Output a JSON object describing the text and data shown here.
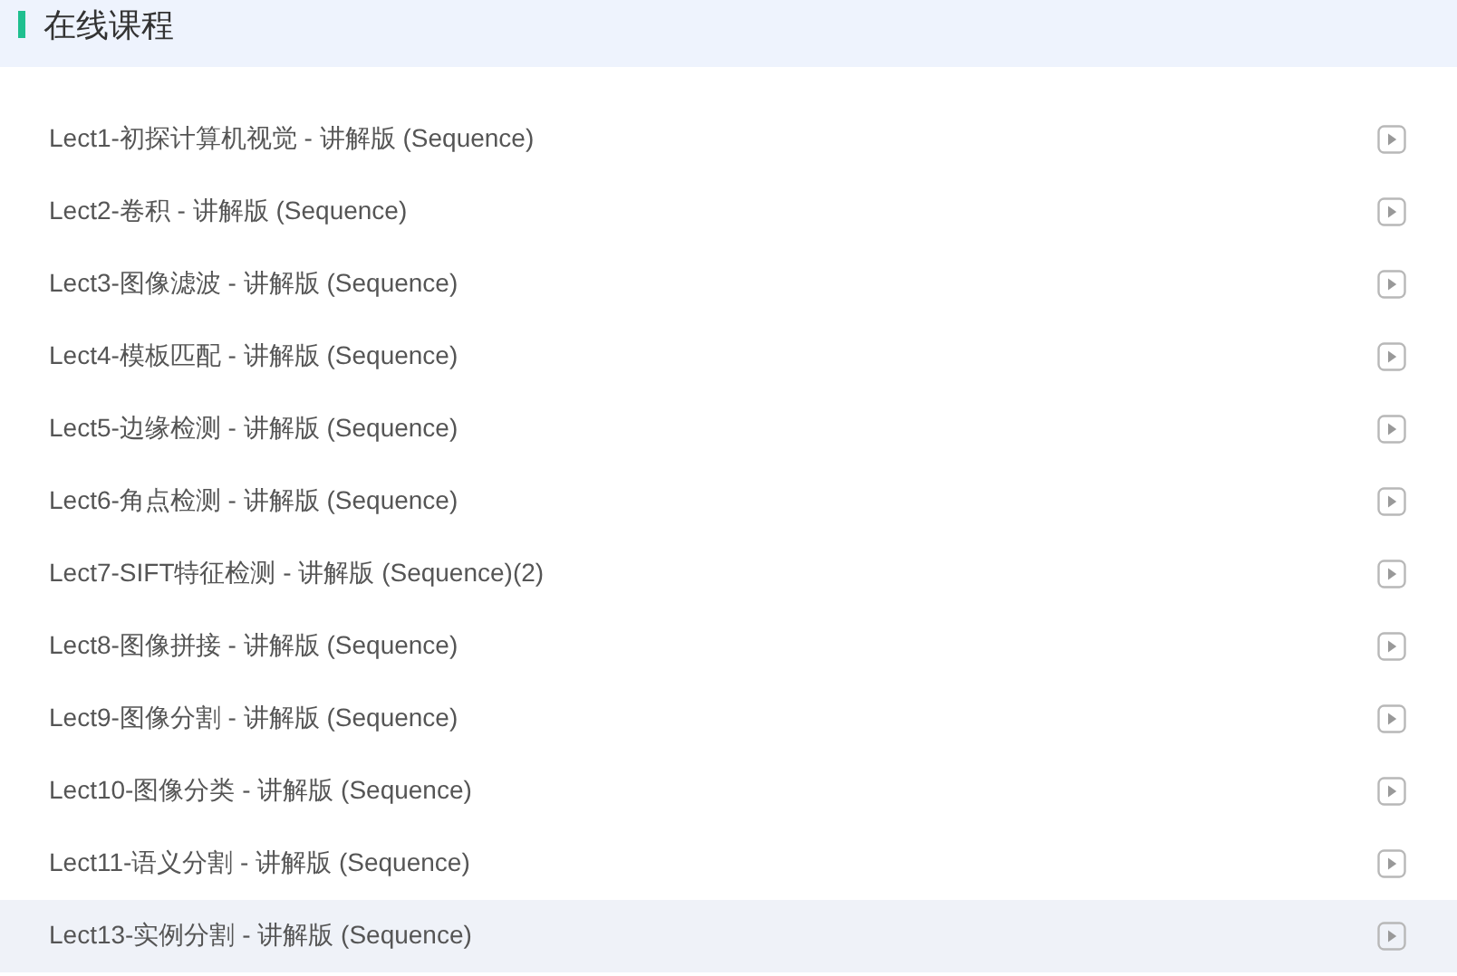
{
  "header": {
    "title": "在线课程"
  },
  "lessons": [
    {
      "title": "Lect1-初探计算机视觉 - 讲解版 (Sequence)",
      "selected": false
    },
    {
      "title": "Lect2-卷积 - 讲解版 (Sequence)",
      "selected": false
    },
    {
      "title": "Lect3-图像滤波 - 讲解版 (Sequence)",
      "selected": false
    },
    {
      "title": "Lect4-模板匹配 - 讲解版 (Sequence)",
      "selected": false
    },
    {
      "title": "Lect5-边缘检测 - 讲解版 (Sequence)",
      "selected": false
    },
    {
      "title": "Lect6-角点检测 - 讲解版 (Sequence)",
      "selected": false
    },
    {
      "title": "Lect7-SIFT特征检测 - 讲解版 (Sequence)(2)",
      "selected": false
    },
    {
      "title": "Lect8-图像拼接 - 讲解版 (Sequence)",
      "selected": false
    },
    {
      "title": "Lect9-图像分割 - 讲解版 (Sequence)",
      "selected": false
    },
    {
      "title": "Lect10-图像分类 - 讲解版 (Sequence)",
      "selected": false
    },
    {
      "title": "Lect11-语义分割 - 讲解版 (Sequence)",
      "selected": false
    },
    {
      "title": "Lect13-实例分割 - 讲解版 (Sequence)",
      "selected": true
    }
  ]
}
